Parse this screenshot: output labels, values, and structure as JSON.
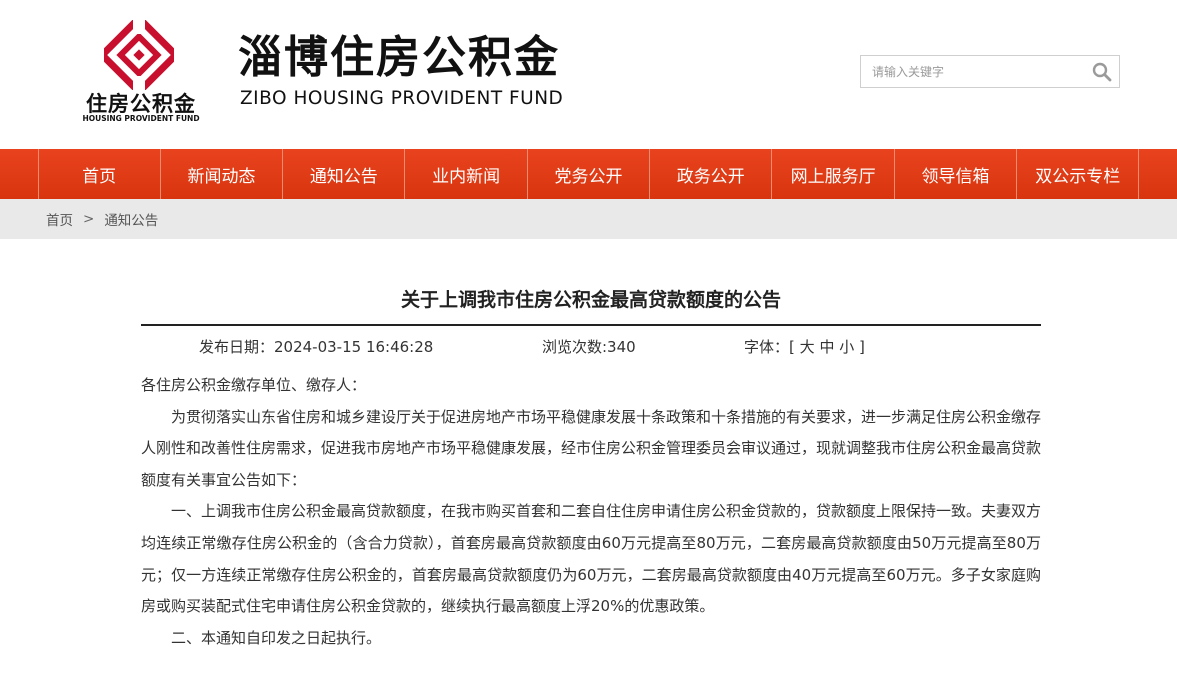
{
  "header": {
    "logo_cn": "住房公积金",
    "logo_en": "HOUSING PROVIDENT FUND",
    "title_cn": "淄博住房公积金",
    "title_en": "ZIBO HOUSING PROVIDENT FUND",
    "search_placeholder": "请输入关键字",
    "search_icon": "search-icon"
  },
  "nav": {
    "items": [
      "首页",
      "新闻动态",
      "通知公告",
      "业内新闻",
      "党务公开",
      "政务公开",
      "网上服务厅",
      "领导信箱",
      "双公示专栏"
    ]
  },
  "breadcrumb": {
    "home": "首页",
    "separator": ">",
    "current": "通知公告"
  },
  "article": {
    "title": "关于上调我市住房公积金最高贷款额度的公告",
    "publish_date": "发布日期：2024-03-15 16:46:28",
    "views": "浏览次数:340",
    "font_label": "字体：[",
    "font_large": "大",
    "font_medium": "中",
    "font_small": "小",
    "font_close": "]",
    "paragraphs": [
      "各住房公积金缴存单位、缴存人：",
      "为贯彻落实山东省住房和城乡建设厅关于促进房地产市场平稳健康发展十条政策和十条措施的有关要求，进一步满足住房公积金缴存人刚性和改善性住房需求，促进我市房地产市场平稳健康发展，经市住房公积金管理委员会审议通过，现就调整我市住房公积金最高贷款额度有关事宜公告如下：",
      "一、上调我市住房公积金最高贷款额度，在我市购买首套和二套自住住房申请住房公积金贷款的，贷款额度上限保持一致。夫妻双方均连续正常缴存住房公积金的（含合力贷款），首套房最高贷款额度由60万元提高至80万元，二套房最高贷款额度由50万元提高至80万元；仅一方连续正常缴存住房公积金的，首套房最高贷款额度仍为60万元，二套房最高贷款额度由40万元提高至60万元。多子女家庭购房或购买装配式住宅申请住房公积金贷款的，继续执行最高额度上浮20%的优惠政策。",
      "二、本通知自印发之日起执行。"
    ]
  },
  "colors": {
    "nav_bg": "#dd3a13",
    "logo_red": "#c8102e",
    "breadcrumb_bg": "#e9e9e9"
  }
}
